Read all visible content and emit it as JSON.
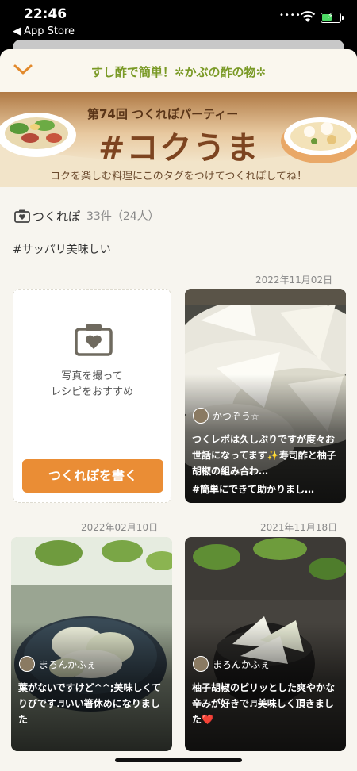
{
  "status": {
    "time": "22:46",
    "back_label": "◀ App Store",
    "dots": "••••"
  },
  "header": {
    "title": "すし酢で簡単！✲かぶの酢の物✲"
  },
  "banner": {
    "subtitle": "第74回 つくれぽパーティー",
    "tag": "#コクうま",
    "description": "コクを楽しむ料理にこのタグをつけてつくれぽしてね！"
  },
  "tsukurepo": {
    "label": "つくれぽ",
    "count": "33件（24人）",
    "hashtag": "#サッパリ美味しい"
  },
  "write_card": {
    "text": "写真を撮って\nレシピをおすすめ",
    "button": "つくれぽを書く"
  },
  "reports": [
    {
      "date": "2022年11月02日",
      "author": "かつぞう☆",
      "comment": "つくレポは久しぶりですが度々お世話になってます✨寿司酢と柚子胡椒の組み合わ…",
      "tags": "#簡単にできて助かりまし…"
    },
    {
      "date": "2022年02月10日",
      "author": "まろんかふぇ",
      "comment": "葉がないですけど^^;美味しくてりびです♬いい箸休めになりました"
    },
    {
      "date": "2021年11月18日",
      "author": "まろんかふぇ",
      "comment": "柚子胡椒のピリッとした爽やかな辛みが好きで♬美味しく頂きました",
      "comment_emoji": "❤️"
    }
  ],
  "colors": {
    "accent_green": "#7a9a26",
    "button_orange": "#ea8d35",
    "background": "#f7f5ef"
  }
}
